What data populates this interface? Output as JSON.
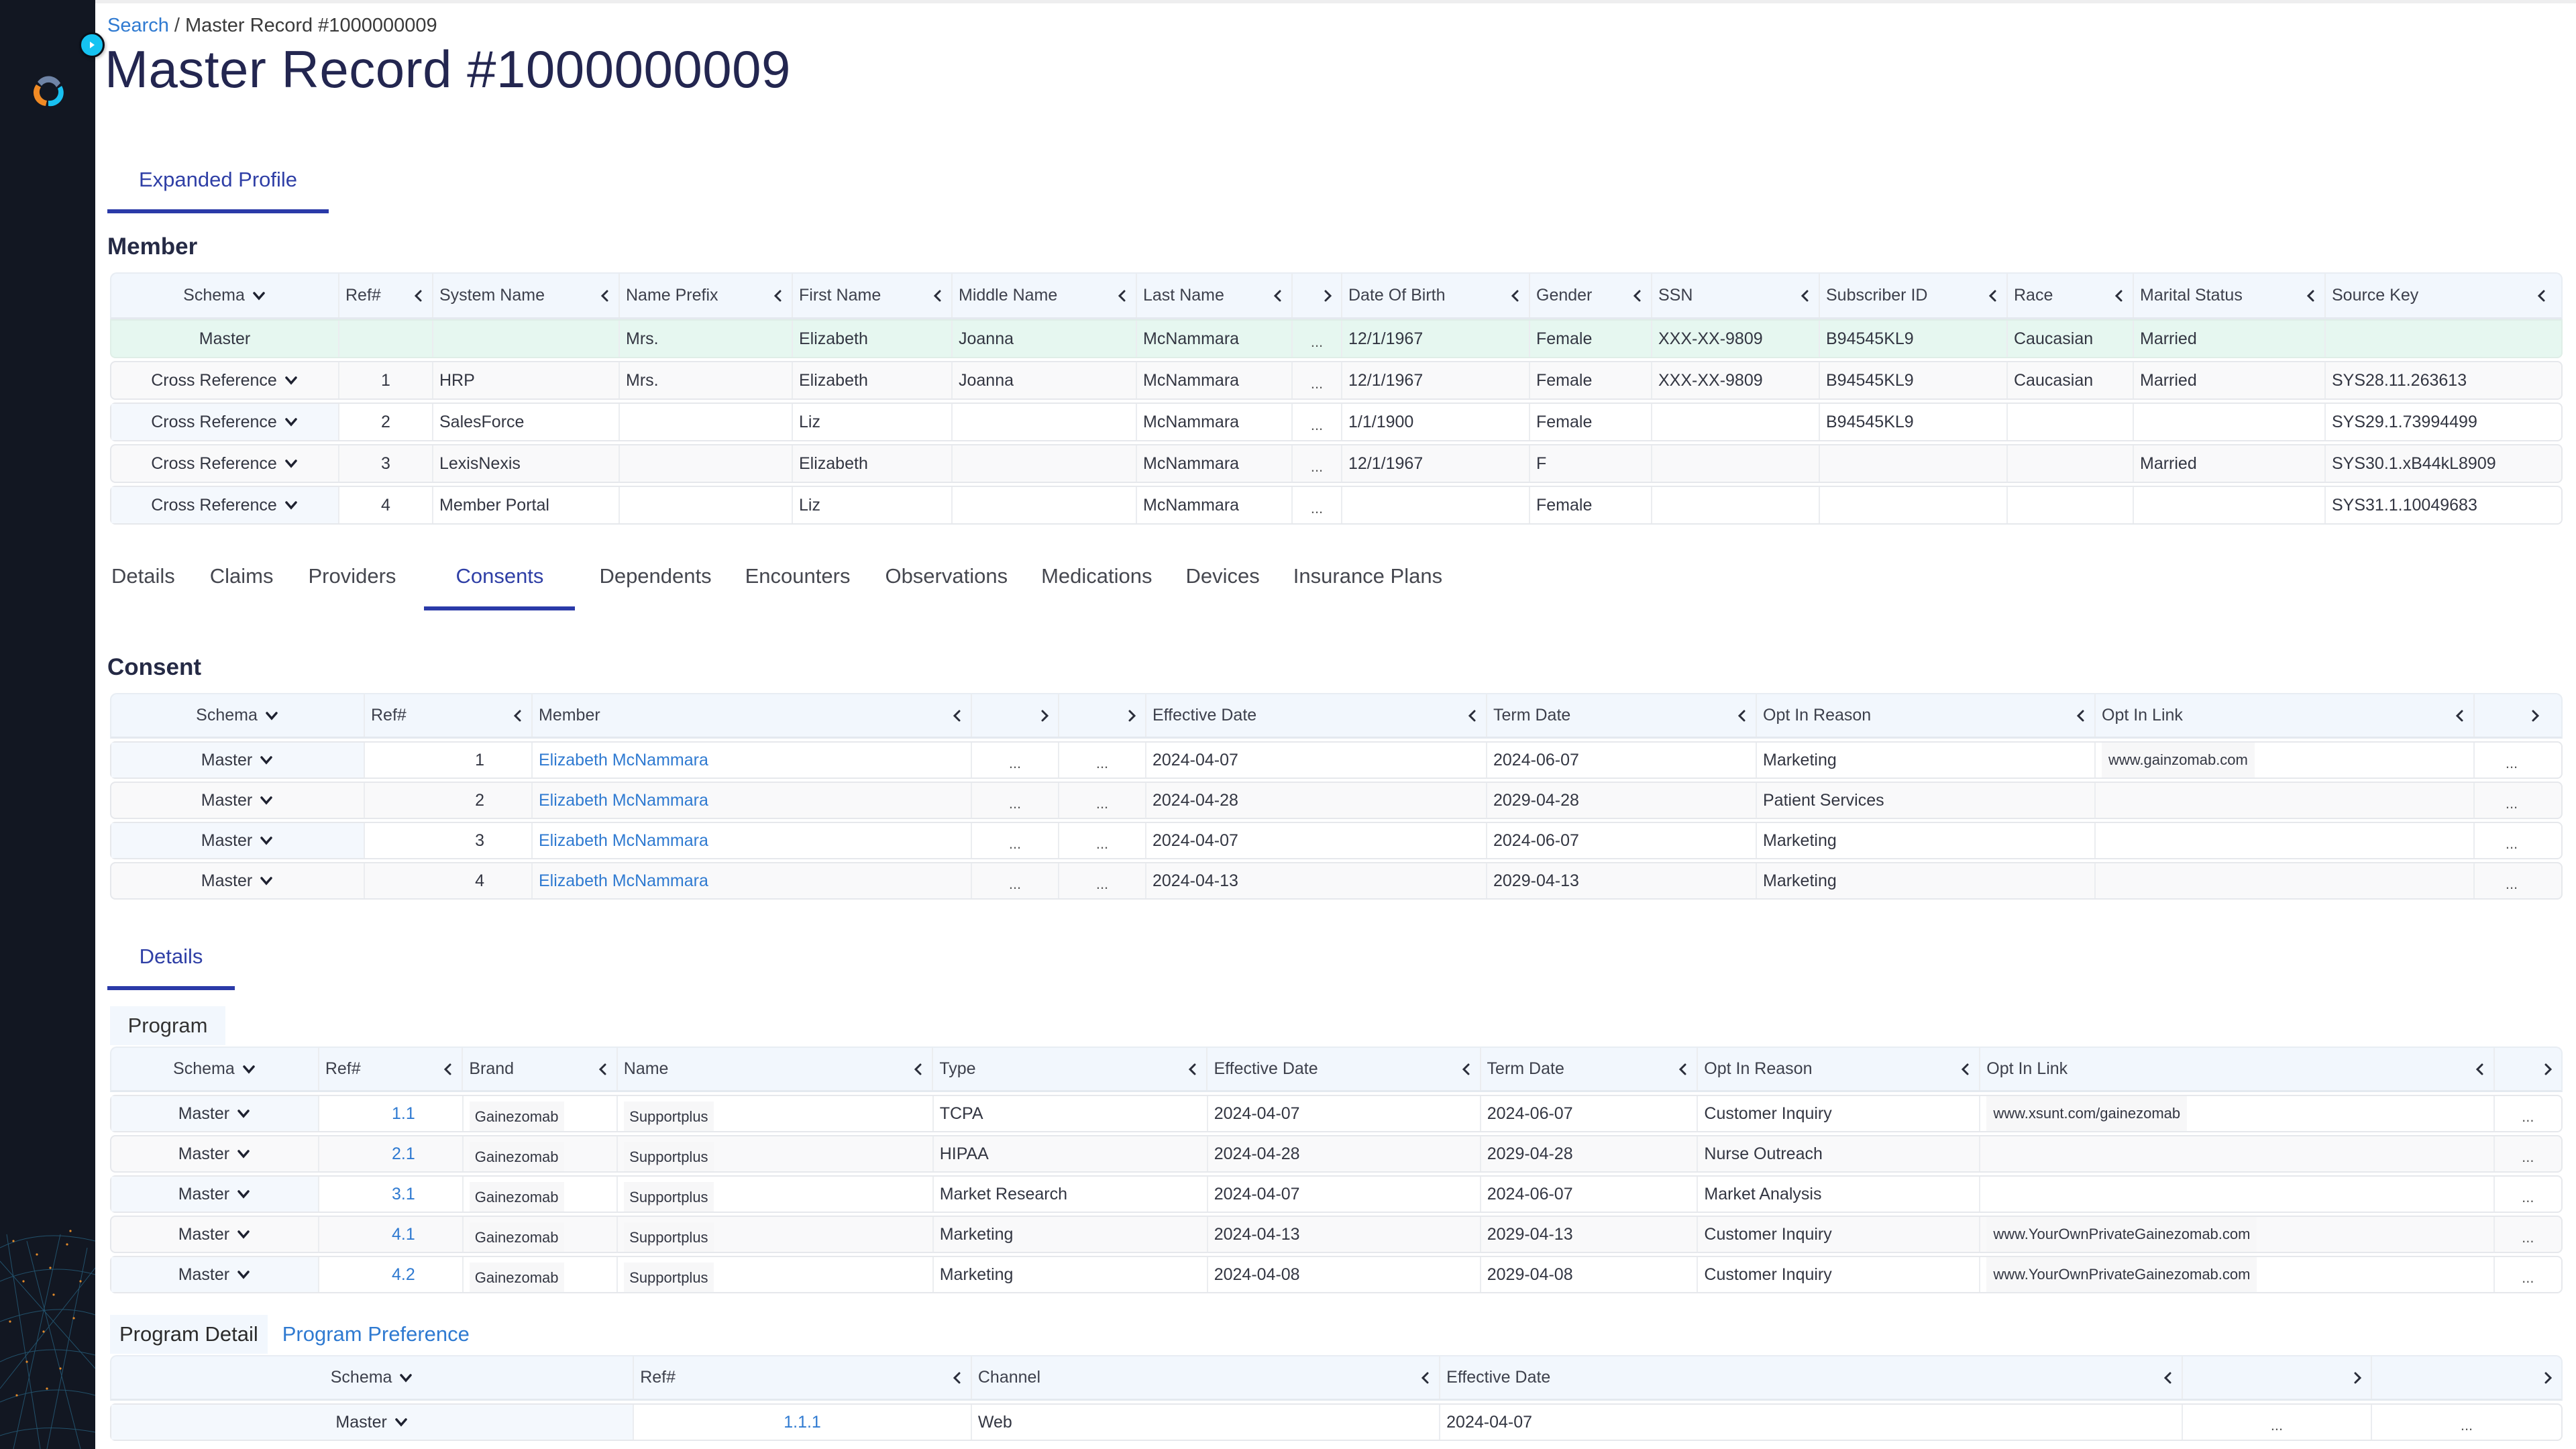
{
  "app": {
    "logo_icon": "swirl-logo-icon",
    "expand_toggle_icon": "play-right-icon",
    "colors": {
      "sidebar": "#121722",
      "accent": "#2a3aa8",
      "link": "#2f7ad1",
      "master_row": "#e6f7f0",
      "header_bg": "#f2f7fd",
      "toggle": "#15c3f2"
    }
  },
  "breadcrumb": {
    "link": "Search",
    "separator": "/",
    "current": "Master Record #1000000009"
  },
  "page_title": "Master Record #1000000009",
  "profile_tabs": [
    {
      "label": "Expanded Profile",
      "active": true
    }
  ],
  "member": {
    "heading": "Member",
    "columns": [
      "Schema",
      "Ref#",
      "System Name",
      "Name Prefix",
      "First Name",
      "Middle Name",
      "Last Name",
      "",
      "Date Of Birth",
      "Gender",
      "SSN",
      "Subscriber ID",
      "Race",
      "Marital Status",
      "Source Key"
    ],
    "rows": [
      {
        "schema": "Master",
        "ref": "",
        "system": "",
        "prefix": "Mrs.",
        "first": "Elizabeth",
        "middle": "Joanna",
        "last": "McNammara",
        "more": "...",
        "dob": "12/1/1967",
        "gender": "Female",
        "ssn": "XXX-XX-9809",
        "subscriber": "B94545KL9",
        "race": "Caucasian",
        "marital": "Married",
        "source": ""
      },
      {
        "schema": "Cross Reference",
        "ref": "1",
        "system": "HRP",
        "prefix": "Mrs.",
        "first": "Elizabeth",
        "middle": "Joanna",
        "last": "McNammara",
        "more": "...",
        "dob": "12/1/1967",
        "gender": "Female",
        "ssn": "XXX-XX-9809",
        "subscriber": "B94545KL9",
        "race": "Caucasian",
        "marital": "Married",
        "source": "SYS28.11.263613"
      },
      {
        "schema": "Cross Reference",
        "ref": "2",
        "system": "SalesForce",
        "prefix": "",
        "first": "Liz",
        "middle": "",
        "last": "McNammara",
        "more": "...",
        "dob": "1/1/1900",
        "gender": "Female",
        "ssn": "",
        "subscriber": "B94545KL9",
        "race": "",
        "marital": "",
        "source": "SYS29.1.73994499"
      },
      {
        "schema": "Cross Reference",
        "ref": "3",
        "system": "LexisNexis",
        "prefix": "",
        "first": "Elizabeth",
        "middle": "",
        "last": "McNammara",
        "more": "...",
        "dob": "12/1/1967",
        "gender": "F",
        "ssn": "",
        "subscriber": "",
        "race": "",
        "marital": "Married",
        "source": "SYS30.1.xB44kL8909"
      },
      {
        "schema": "Cross Reference",
        "ref": "4",
        "system": "Member Portal",
        "prefix": "",
        "first": "Liz",
        "middle": "",
        "last": "McNammara",
        "more": "...",
        "dob": "",
        "gender": "Female",
        "ssn": "",
        "subscriber": "",
        "race": "",
        "marital": "",
        "source": "SYS31.1.10049683"
      }
    ]
  },
  "sub_tabs": [
    {
      "label": "Details",
      "active": false
    },
    {
      "label": "Claims",
      "active": false
    },
    {
      "label": "Providers",
      "active": false
    },
    {
      "label": "Consents",
      "active": true
    },
    {
      "label": "Dependents",
      "active": false
    },
    {
      "label": "Encounters",
      "active": false
    },
    {
      "label": "Observations",
      "active": false
    },
    {
      "label": "Medications",
      "active": false
    },
    {
      "label": "Devices",
      "active": false
    },
    {
      "label": "Insurance Plans",
      "active": false
    }
  ],
  "consent": {
    "heading": "Consent",
    "columns": [
      "Schema",
      "Ref#",
      "Member",
      "",
      "",
      "Effective Date",
      "Term Date",
      "Opt In Reason",
      "Opt In Link",
      ""
    ],
    "rows": [
      {
        "schema": "Master",
        "ref": "1",
        "member": "Elizabeth McNammara",
        "c1": "...",
        "c2": "...",
        "effective": "2024-04-07",
        "term": "2024-06-07",
        "reason": "Marketing",
        "link": "www.gainzomab.com",
        "more": "..."
      },
      {
        "schema": "Master",
        "ref": "2",
        "member": "Elizabeth McNammara",
        "c1": "...",
        "c2": "...",
        "effective": "2024-04-28",
        "term": "2029-04-28",
        "reason": "Patient Services",
        "link": "",
        "more": "..."
      },
      {
        "schema": "Master",
        "ref": "3",
        "member": "Elizabeth McNammara",
        "c1": "...",
        "c2": "...",
        "effective": "2024-04-07",
        "term": "2024-06-07",
        "reason": "Marketing",
        "link": "",
        "more": "..."
      },
      {
        "schema": "Master",
        "ref": "4",
        "member": "Elizabeth McNammara",
        "c1": "...",
        "c2": "...",
        "effective": "2024-04-13",
        "term": "2029-04-13",
        "reason": "Marketing",
        "link": "",
        "more": "..."
      }
    ]
  },
  "details_tabs": [
    {
      "label": "Details",
      "active": true
    }
  ],
  "program": {
    "label": "Program",
    "columns": [
      "Schema",
      "Ref#",
      "Brand",
      "Name",
      "Type",
      "Effective Date",
      "Term Date",
      "Opt In Reason",
      "Opt In Link",
      ""
    ],
    "rows": [
      {
        "schema": "Master",
        "ref": "1.1",
        "brand": "Gainezomab",
        "name": "Supportplus",
        "type": "TCPA",
        "effective": "2024-04-07",
        "term": "2024-06-07",
        "reason": "Customer Inquiry",
        "link": "www.xsunt.com/gainezomab",
        "more": "..."
      },
      {
        "schema": "Master",
        "ref": "2.1",
        "brand": "Gainezomab",
        "name": "Supportplus",
        "type": "HIPAA",
        "effective": "2024-04-28",
        "term": "2029-04-28",
        "reason": "Nurse Outreach",
        "link": "",
        "more": "..."
      },
      {
        "schema": "Master",
        "ref": "3.1",
        "brand": "Gainezomab",
        "name": "Supportplus",
        "type": "Market Research",
        "effective": "2024-04-07",
        "term": "2024-06-07",
        "reason": "Market Analysis",
        "link": "",
        "more": "..."
      },
      {
        "schema": "Master",
        "ref": "4.1",
        "brand": "Gainezomab",
        "name": "Supportplus",
        "type": "Marketing",
        "effective": "2024-04-13",
        "term": "2029-04-13",
        "reason": "Customer Inquiry",
        "link": "www.YourOwnPrivateGainezomab.com",
        "more": "..."
      },
      {
        "schema": "Master",
        "ref": "4.2",
        "brand": "Gainezomab",
        "name": "Supportplus",
        "type": "Marketing",
        "effective": "2024-04-08",
        "term": "2029-04-08",
        "reason": "Customer Inquiry",
        "link": "www.YourOwnPrivateGainezomab.com",
        "more": "..."
      }
    ]
  },
  "program_detail_tabs": [
    {
      "label": "Program Detail",
      "active": true
    },
    {
      "label": "Program Preference",
      "active": false
    }
  ],
  "program_detail": {
    "columns": [
      "Schema",
      "Ref#",
      "Channel",
      "Effective Date",
      "",
      ""
    ],
    "rows": [
      {
        "schema": "Master",
        "ref": "1.1.1",
        "channel": "Web",
        "effective": "2024-04-07",
        "c1": "...",
        "c2": "..."
      }
    ]
  }
}
